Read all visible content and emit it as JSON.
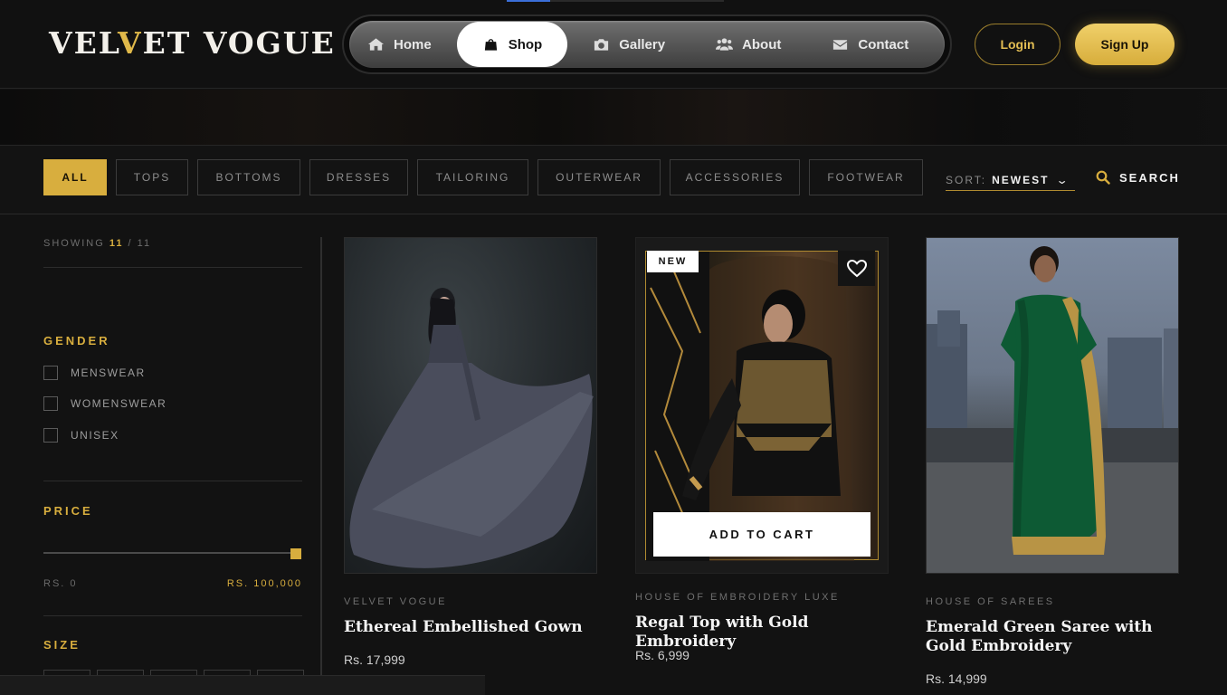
{
  "header": {
    "logo": {
      "part1": "VEL",
      "part2": "V",
      "part3": "ET VOGUE"
    },
    "nav": [
      {
        "label": "Home",
        "icon": "home-icon"
      },
      {
        "label": "Shop",
        "icon": "bag-icon",
        "active": true
      },
      {
        "label": "Gallery",
        "icon": "camera-icon"
      },
      {
        "label": "About",
        "icon": "users-icon"
      },
      {
        "label": "Contact",
        "icon": "envelope-icon"
      }
    ],
    "login_label": "Login",
    "signup_label": "Sign Up",
    "accent_color": "#d8ae3e"
  },
  "filters": {
    "categories": [
      "ALL",
      "TOPS",
      "BOTTOMS",
      "DRESSES",
      "TAILORING",
      "OUTERWEAR",
      "ACCESSORIES",
      "FOOTWEAR"
    ],
    "active_category": "ALL",
    "sort_label": "SORT:",
    "sort_value": "NEWEST",
    "search_label": "SEARCH"
  },
  "sidebar": {
    "showing_label": "SHOWING",
    "showing_count": "11",
    "showing_sep": "/",
    "showing_total": "11",
    "gender_title": "GENDER",
    "gender_options": [
      "MENSWEAR",
      "WOMENSWEAR",
      "UNISEX"
    ],
    "price_title": "PRICE",
    "price_min": "RS. 0",
    "price_max": "RS. 100,000",
    "price_slider_fraction": 1.0,
    "size_title": "SIZE"
  },
  "products": [
    {
      "brand": "VELVET VOGUE",
      "name": "Ethereal Embellished Gown",
      "price": "Rs. 17,999"
    },
    {
      "brand": "HOUSE OF EMBROIDERY LUXE",
      "name": "Regal Top with Gold Embroidery",
      "price": "Rs. 6,999",
      "badge": "NEW",
      "cart_label": "ADD TO CART"
    },
    {
      "brand": "HOUSE OF SAREES",
      "name": "Emerald Green Saree with Gold Embroidery",
      "price": "Rs. 14,999"
    }
  ]
}
